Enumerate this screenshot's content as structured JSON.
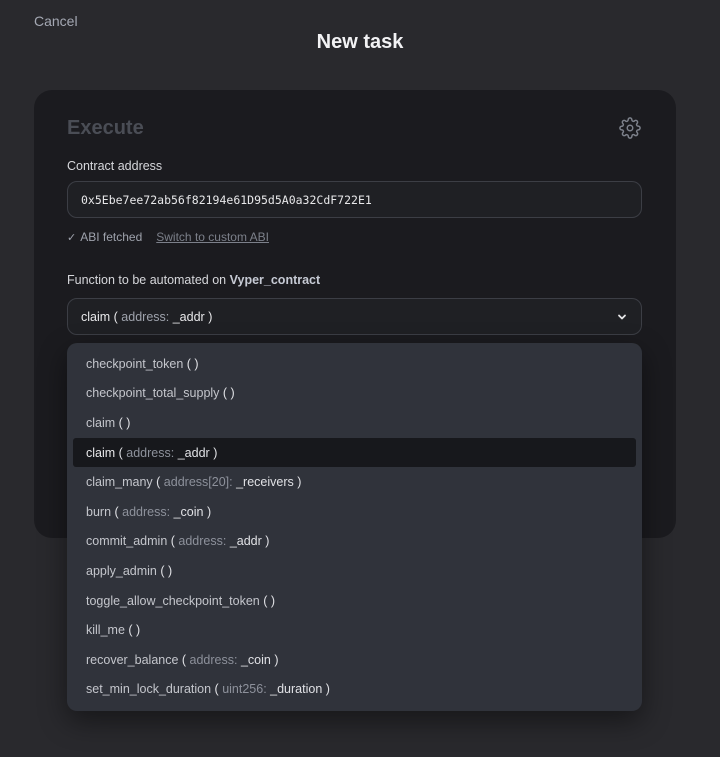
{
  "header": {
    "cancel_label": "Cancel",
    "title": "New task"
  },
  "card": {
    "title": "Execute",
    "icon": "gear-icon",
    "contract_label": "Contract address",
    "contract_address": "0x5Ebe7ee72ab56f82194e61D95d5A0a32CdF722E1",
    "abi_status": "ABI fetched",
    "abi_switch_label": "Switch to custom ABI",
    "function_label_prefix": "Function to be automated on ",
    "contract_name": "Vyper_contract",
    "selected_function": {
      "name": "claim",
      "param_type": "address:",
      "param_name": "_addr"
    }
  },
  "dropdown": {
    "selected_index": 3,
    "options": [
      {
        "name": "checkpoint_token",
        "param_type": "",
        "param_name": ""
      },
      {
        "name": "checkpoint_total_supply",
        "param_type": "",
        "param_name": ""
      },
      {
        "name": "claim",
        "param_type": "",
        "param_name": ""
      },
      {
        "name": "claim",
        "param_type": "address:",
        "param_name": "_addr"
      },
      {
        "name": "claim_many",
        "param_type": "address[20]:",
        "param_name": "_receivers"
      },
      {
        "name": "burn",
        "param_type": "address:",
        "param_name": "_coin"
      },
      {
        "name": "commit_admin",
        "param_type": "address:",
        "param_name": "_addr"
      },
      {
        "name": "apply_admin",
        "param_type": "",
        "param_name": ""
      },
      {
        "name": "toggle_allow_checkpoint_token",
        "param_type": "",
        "param_name": ""
      },
      {
        "name": "kill_me",
        "param_type": "",
        "param_name": ""
      },
      {
        "name": "recover_balance",
        "param_type": "address:",
        "param_name": "_coin"
      },
      {
        "name": "set_min_lock_duration",
        "param_type": "uint256:",
        "param_name": "_duration"
      }
    ]
  }
}
